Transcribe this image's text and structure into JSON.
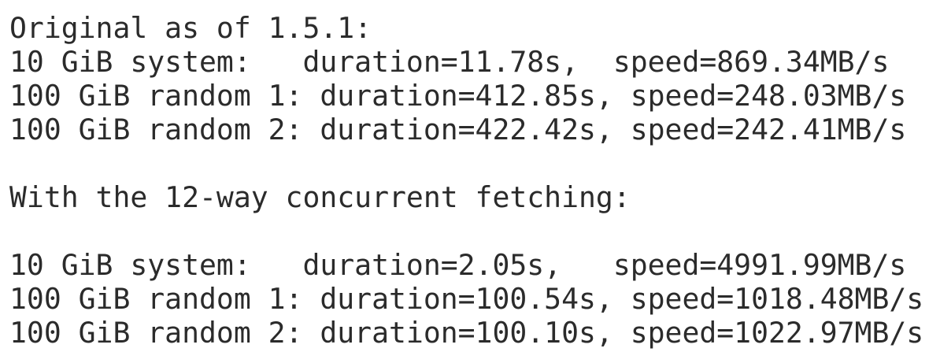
{
  "lines": [
    "Original as of 1.5.1:",
    "10 GiB system:   duration=11.78s,  speed=869.34MB/s",
    "100 GiB random 1: duration=412.85s, speed=248.03MB/s",
    "100 GiB random 2: duration=422.42s, speed=242.41MB/s",
    "",
    "With the 12-way concurrent fetching:",
    "",
    "10 GiB system:   duration=2.05s,   speed=4991.99MB/s",
    "100 GiB random 1: duration=100.54s, speed=1018.48MB/s",
    "100 GiB random 2: duration=100.10s, speed=1022.97MB/s"
  ]
}
